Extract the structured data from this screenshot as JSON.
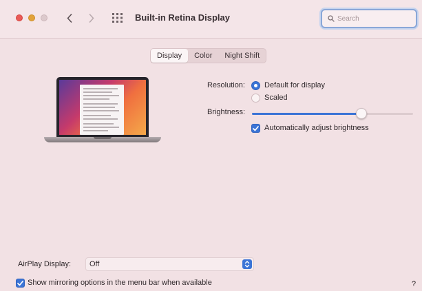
{
  "window": {
    "title": "Built-in Retina Display"
  },
  "titlebar": {
    "search_placeholder": "Search",
    "back_icon": "chevron-left-icon",
    "forward_icon": "chevron-right-icon",
    "grid_icon": "grid-icon"
  },
  "tabs": [
    {
      "label": "Display",
      "active": true
    },
    {
      "label": "Color",
      "active": false
    },
    {
      "label": "Night Shift",
      "active": false
    }
  ],
  "display": {
    "resolution_label": "Resolution:",
    "resolution_options": [
      {
        "label": "Default for display",
        "selected": true
      },
      {
        "label": "Scaled",
        "selected": false
      }
    ],
    "brightness_label": "Brightness:",
    "brightness_level": 0.68,
    "auto_brightness_label": "Automatically adjust brightness",
    "auto_brightness_checked": true
  },
  "airplay": {
    "label": "AirPlay Display:",
    "value": "Off"
  },
  "mirroring": {
    "label": "Show mirroring options in the menu bar when available",
    "checked": true
  },
  "help": {
    "label": "?"
  },
  "colors": {
    "accent": "#3b74d6",
    "background": "#f2e1e4",
    "close": "#e95a57",
    "minimize": "#e2a33a"
  }
}
